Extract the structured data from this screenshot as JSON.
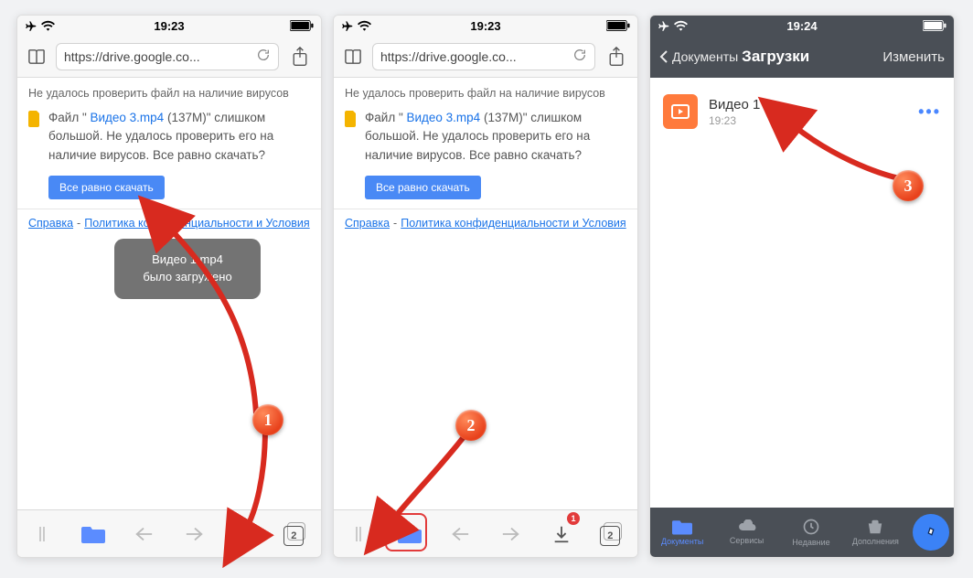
{
  "screens": [
    {
      "status_time": "19:23",
      "url": "https://drive.google.co...",
      "warn_heading": "Не удалось проверить файл на наличие вирусов",
      "filemsg_prefix": "Файл \"",
      "filemsg_link": " Видео 3.mp4 ",
      "filemsg_suffix": "(137M)\" слишком большой. Не удалось проверить его на наличие вирусов. Все равно скачать?",
      "dl_button": "Все равно скачать",
      "help_link": "Справка",
      "privacy_link": "Политика конфиденциальности и Условия ",
      "toast_line1": "Видео 1.mp4",
      "toast_line2": "было загружено",
      "tab_count": "2"
    },
    {
      "status_time": "19:23",
      "url": "https://drive.google.co...",
      "warn_heading": "Не удалось проверить файл на наличие вирусов",
      "filemsg_prefix": "Файл \"",
      "filemsg_link": " Видео 3.mp4 ",
      "filemsg_suffix": "(137M)\" слишком большой. Не удалось проверить его на наличие вирусов. Все равно скачать?",
      "dl_button": "Все равно скачать",
      "help_link": "Справка",
      "privacy_link": "Политика конфиденциальности и Условия ",
      "tab_count": "2",
      "dl_badge": "1"
    },
    {
      "status_time": "19:24",
      "back_label": "Документы",
      "title": "Загрузки",
      "edit_label": "Изменить",
      "file_name": "Видео 1",
      "file_time": "19:23",
      "tabs": {
        "docs": "Документы",
        "services": "Сервисы",
        "recent": "Недавние",
        "addons": "Дополнения"
      }
    }
  ],
  "step_labels": {
    "s1": "1",
    "s2": "2",
    "s3": "3"
  }
}
